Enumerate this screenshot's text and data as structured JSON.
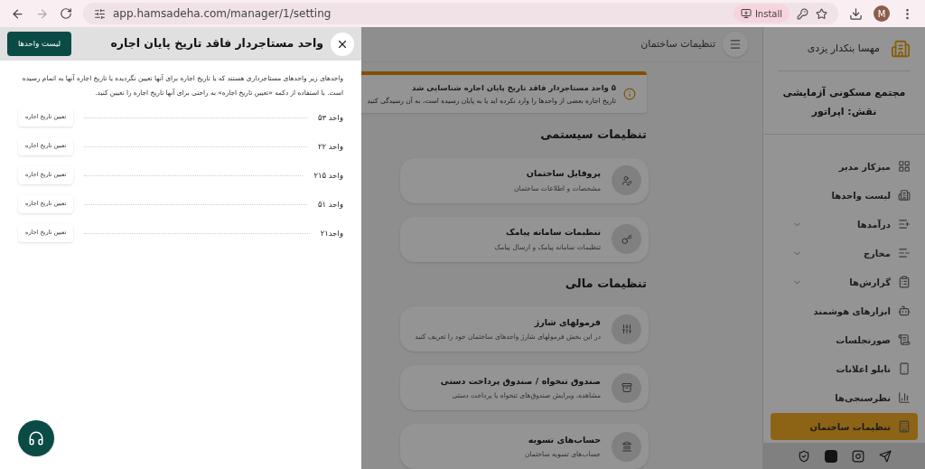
{
  "browser": {
    "url": "app.hamsadeha.com/manager/1/setting",
    "install_label": "Install",
    "avatar_letter": "M"
  },
  "drawer": {
    "title": "واحد مستاجردار فاقد تاریخ پایان اجاره",
    "list_button": "لیست واحدها",
    "description": "واحدهای زیر واحدهای مستاجرداری هستند که یا تاریخ اجاره برای آنها تعیین نگردیده یا تاریخ اجاره آنها به اتمام رسیده است. با استفاده از دکمه «تعیین تاریخ اجاره» به راحتی برای آنها تاریخ اجاره را تعیین کنید.",
    "units": [
      {
        "name": "واحد ۵۳",
        "button": "تعیین تاریخ اجاره"
      },
      {
        "name": "واحد ۲۲",
        "button": "تعیین تاریخ اجاره"
      },
      {
        "name": "واحد ۲۱۵",
        "button": "تعیین تاریخ اجاره"
      },
      {
        "name": "واحد ۵۱",
        "button": "تعیین تاریخ اجاره"
      },
      {
        "name": "واحد۲۱",
        "button": "تعیین تاریخ اجاره"
      }
    ]
  },
  "header": {
    "title": "تنظیمات ساختمان"
  },
  "alert": {
    "title": "۵ واحد مستاجردار فاقد تاریخ پایان اجاره شناسایی شد",
    "message": "تاریخ اجاره بعضی از واحدها را وارد نکرده اید یا به پایان رسیده است، به آن رسیدگی کنید"
  },
  "sections": [
    {
      "title": "تنظیمات سیستمی",
      "cards": [
        {
          "kind": "profile",
          "title": "پروفایل ساختمان",
          "subtitle": "مشخصات و اطلاعات ساختمان"
        },
        {
          "kind": "sms",
          "title": "تنظیمات سامانه پیامک",
          "subtitle": "تنظیمات سامانه پیامک و ارسال پیامک"
        }
      ]
    },
    {
      "title": "تنظیمات مالی",
      "cards": [
        {
          "kind": "formula",
          "title": "فرمولهای شارژ",
          "subtitle": "در این بخش فرمولهای شارژ واحدهای ساختمان خود را تعریف کنید"
        },
        {
          "kind": "cashbox",
          "title": "صندوق تنخواه / صندوق پرداخت دستی",
          "subtitle": "مشاهده، ویرایش صندوق‌های تنخواه یا پرداخت دستی"
        },
        {
          "kind": "bank",
          "title": "حساب‌های تسویه",
          "subtitle": "حساب‌های تسویه ساختمان"
        }
      ]
    }
  ],
  "sidebar": {
    "user_name": "مهسا بنکدار یزدی",
    "complex_name": "مجتمع مسکونی آزمایشی",
    "role": "نقش: اپراتور",
    "items": [
      {
        "kind": "dashboard",
        "label": "میزکار مدیر",
        "has_submenu": false,
        "selected": false
      },
      {
        "kind": "units",
        "label": "لیست واحدها",
        "has_submenu": false,
        "selected": false
      },
      {
        "kind": "income",
        "label": "درآمدها",
        "has_submenu": true,
        "selected": false
      },
      {
        "kind": "expense",
        "label": "مخارج",
        "has_submenu": true,
        "selected": false
      },
      {
        "kind": "reports",
        "label": "گزارش‌ها",
        "has_submenu": true,
        "selected": false
      },
      {
        "kind": "smart",
        "label": "ابزارهای هوشمند",
        "has_submenu": false,
        "selected": false
      },
      {
        "kind": "minutes",
        "label": "صورتجلسات",
        "has_submenu": false,
        "selected": false
      },
      {
        "kind": "board",
        "label": "تابلو اعلانات",
        "has_submenu": false,
        "selected": false
      },
      {
        "kind": "polls",
        "label": "نظرسنجی‌ها",
        "has_submenu": false,
        "selected": false
      },
      {
        "kind": "settings",
        "label": "تنظیمات ساختمان",
        "has_submenu": false,
        "selected": true
      }
    ]
  }
}
